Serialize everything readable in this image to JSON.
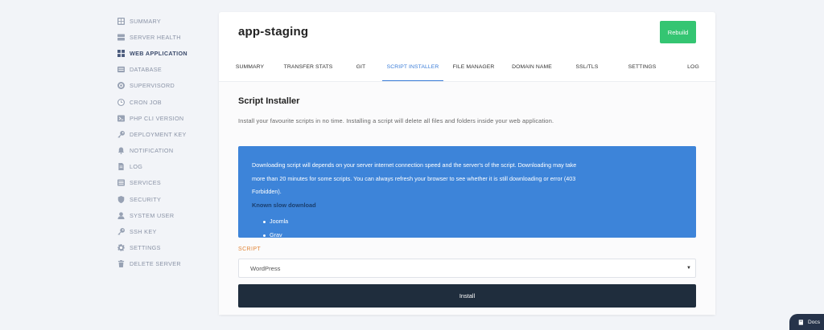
{
  "sidebar": {
    "items": [
      {
        "label": "SUMMARY",
        "icon": "grid-icon"
      },
      {
        "label": "SERVER HEALTH",
        "icon": "server-icon"
      },
      {
        "label": "WEB APPLICATION",
        "icon": "apps-icon"
      },
      {
        "label": "DATABASE",
        "icon": "database-icon"
      },
      {
        "label": "SUPERVISORD",
        "icon": "gear-circle-icon"
      },
      {
        "label": "CRON JOB",
        "icon": "clock-icon"
      },
      {
        "label": "PHP CLI VERSION",
        "icon": "terminal-icon"
      },
      {
        "label": "DEPLOYMENT KEY",
        "icon": "key-icon"
      },
      {
        "label": "NOTIFICATION",
        "icon": "bell-icon"
      },
      {
        "label": "LOG",
        "icon": "file-icon"
      },
      {
        "label": "SERVICES",
        "icon": "list-icon"
      },
      {
        "label": "SECURITY",
        "icon": "shield-icon"
      },
      {
        "label": "SYSTEM USER",
        "icon": "user-icon"
      },
      {
        "label": "SSH KEY",
        "icon": "key-icon"
      },
      {
        "label": "SETTINGS",
        "icon": "gear-icon"
      },
      {
        "label": "DELETE SERVER",
        "icon": "trash-icon"
      }
    ],
    "active_index": 2
  },
  "app": {
    "title": "app-staging",
    "rebuild_label": "Rebuild",
    "accent": "#3b7dd8",
    "rebuild_color": "#34c572"
  },
  "tabs": [
    {
      "label": "SUMMARY"
    },
    {
      "label": "TRANSFER STATS"
    },
    {
      "label": "GIT"
    },
    {
      "label": "SCRIPT INSTALLER"
    },
    {
      "label": "FILE MANAGER"
    },
    {
      "label": "DOMAIN NAME"
    },
    {
      "label": "SSL/TLS"
    },
    {
      "label": "SETTINGS"
    },
    {
      "label": "LOG"
    }
  ],
  "active_tab_index": 3,
  "installer": {
    "title": "Script Installer",
    "description": "Install your favourite scripts in no time. Installing a script will delete all files and folders inside your web application.",
    "info_text": "Downloading script will depends on your server internet connection speed and the server's of the script. Downloading may take more than 20 minutes for some scripts. You can always refresh your browser to see whether it is still downloading or error (403 Forbidden).",
    "slow_title": "Known slow download",
    "slow_list": [
      "Joomla",
      "Grav"
    ],
    "script_label": "SCRIPT",
    "selected_script": "WordPress",
    "install_label": "Install",
    "info_color": "#3d84d9",
    "install_color": "#1f2d3d"
  },
  "docs": {
    "label": "Docs",
    "icon": "book-icon"
  }
}
